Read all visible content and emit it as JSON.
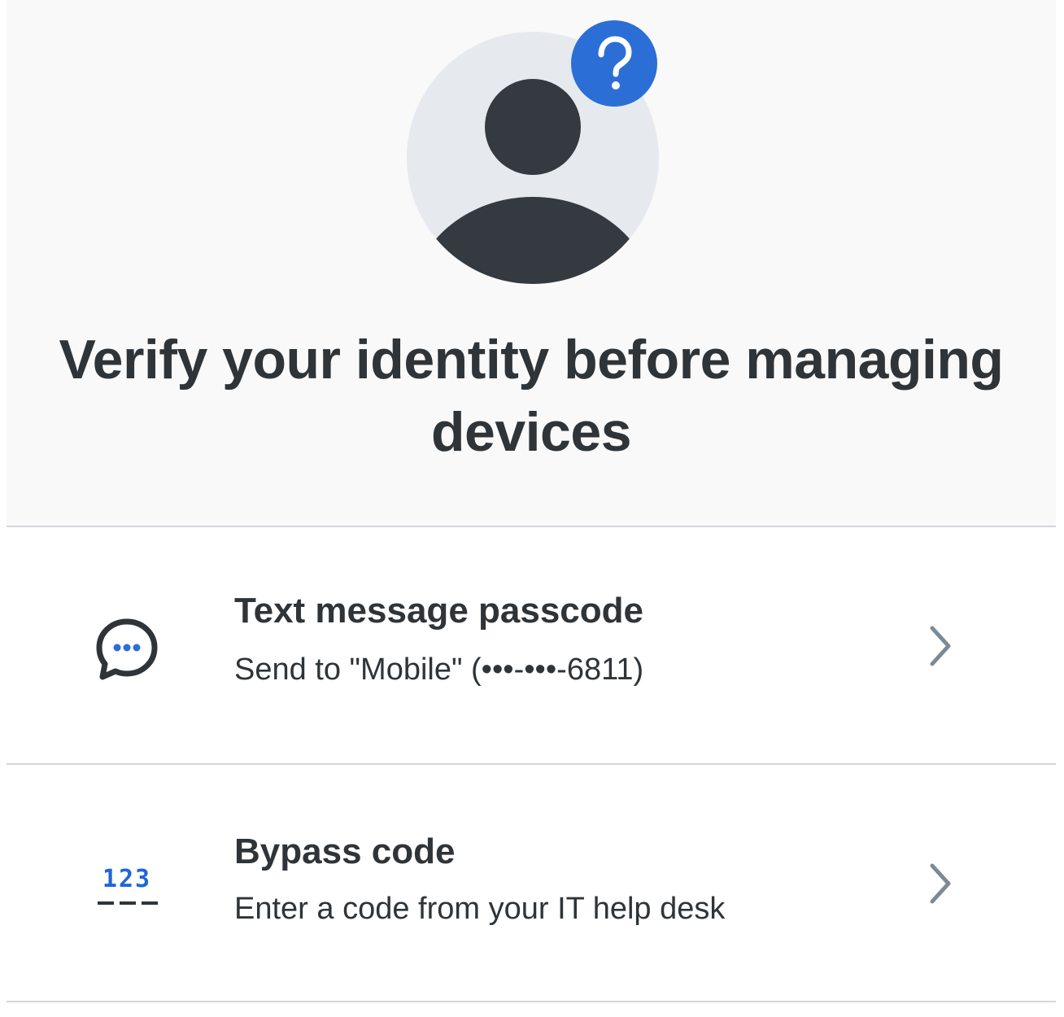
{
  "header": {
    "title": "Verify your identity before managing devices",
    "avatar_icon": "user-avatar-icon",
    "help_icon": "question-mark-icon"
  },
  "options": [
    {
      "icon": "chat-bubble-icon",
      "title": "Text message passcode",
      "subtitle": "Send to \"Mobile\" (•••-•••-6811)"
    },
    {
      "icon": "code-123-icon",
      "icon_text": "123",
      "title": "Bypass code",
      "subtitle": "Enter a code from your IT help desk"
    }
  ],
  "colors": {
    "accent": "#2b6fd6",
    "text": "#2f3438",
    "header_bg": "#f9f9f9",
    "divider": "#d3d6dc",
    "avatar_bg": "#e6eaee"
  }
}
